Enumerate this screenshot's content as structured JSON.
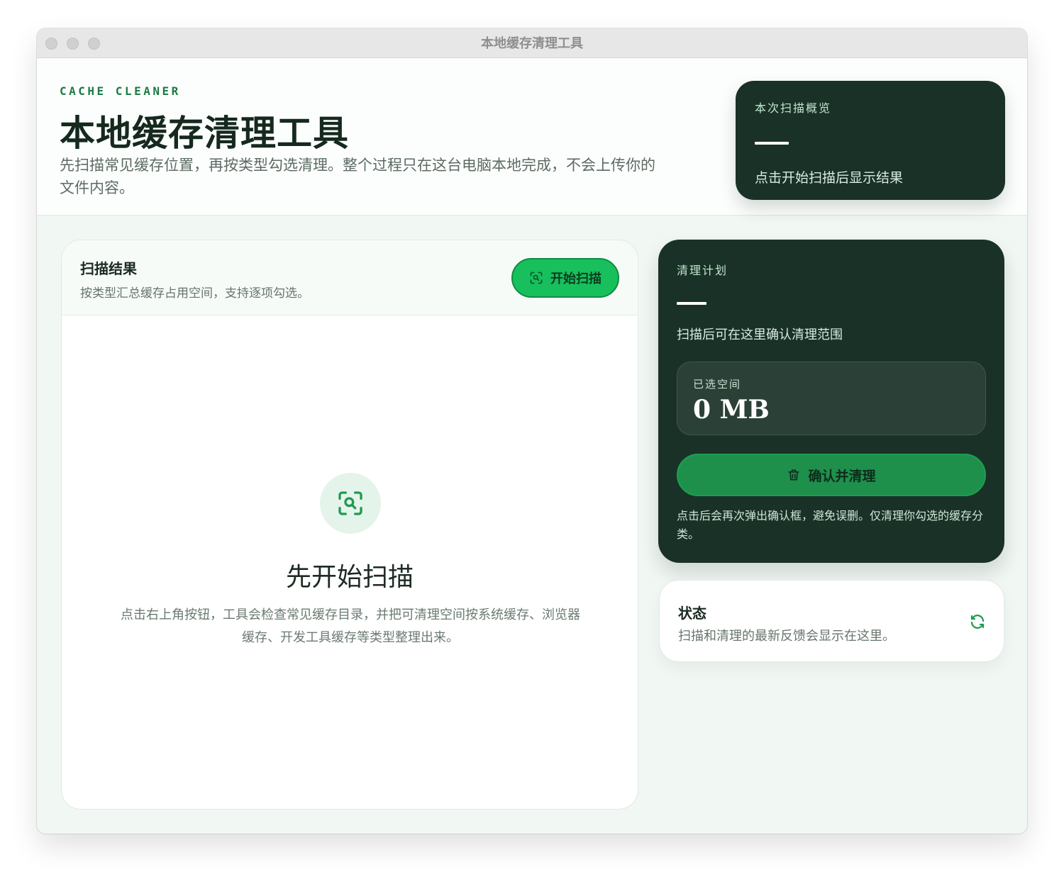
{
  "window": {
    "title": "本地缓存清理工具"
  },
  "header": {
    "eyebrow": "CACHE CLEANER",
    "title": "本地缓存清理工具",
    "description": "先扫描常见缓存位置，再按类型勾选清理。整个过程只在这台电脑本地完成，不会上传你的文件内容。"
  },
  "overview": {
    "label": "本次扫描概览",
    "hint": "点击开始扫描后显示结果"
  },
  "results": {
    "title": "扫描结果",
    "subtitle": "按类型汇总缓存占用空间，支持逐项勾选。",
    "scan_button": "开始扫描",
    "empty_title": "先开始扫描",
    "empty_description": "点击右上角按钮，工具会检查常见缓存目录，并把可清理空间按系统缓存、浏览器缓存、开发工具缓存等类型整理出来。"
  },
  "plan": {
    "label": "清理计划",
    "hint": "扫描后可在这里确认清理范围",
    "selected_caption": "已选空间",
    "selected_value": "0 MB",
    "confirm_button": "确认并清理",
    "note": "点击后会再次弹出确认框，避免误删。仅清理你勾选的缓存分类。"
  },
  "status": {
    "title": "状态",
    "text": "扫描和清理的最新反馈会显示在这里。"
  },
  "colors": {
    "accent": "#17c05c",
    "dark_panel": "#1a3127",
    "confirm": "#1f8f4c",
    "eyebrow": "#1d7a45"
  },
  "icons": {
    "scan": "scan-search-icon",
    "trash": "trash-icon",
    "refresh": "refresh-icon"
  }
}
